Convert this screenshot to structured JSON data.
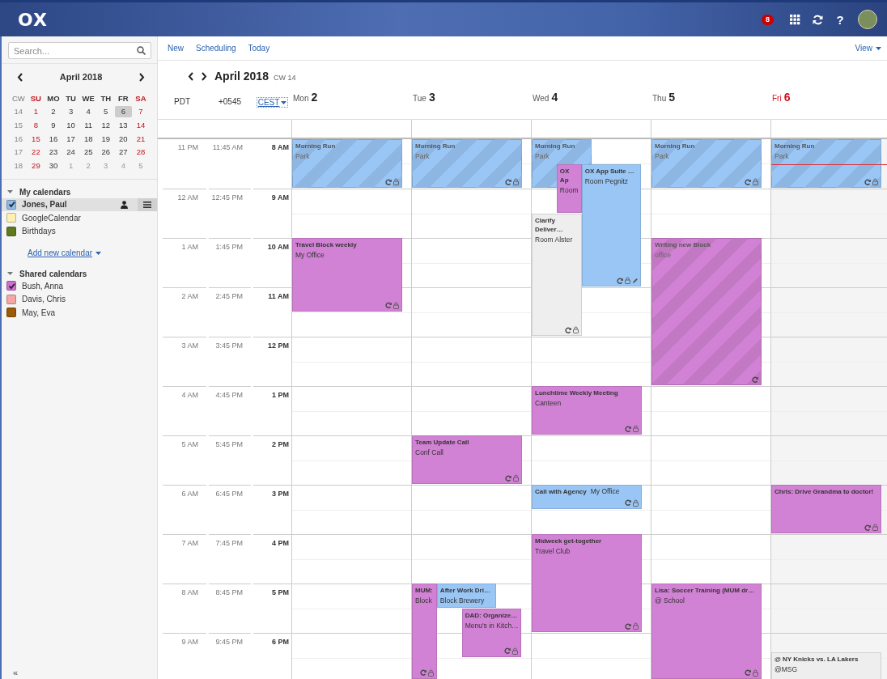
{
  "topbar": {
    "logo": "OX",
    "notification_count": "8",
    "help": "?"
  },
  "search": {
    "placeholder": "Search..."
  },
  "minical": {
    "title": "April 2018",
    "week_header": "CW",
    "headers": [
      {
        "label": "SU",
        "weekend": true
      },
      {
        "label": "MO",
        "weekend": false
      },
      {
        "label": "TU",
        "weekend": false
      },
      {
        "label": "WE",
        "weekend": false
      },
      {
        "label": "TH",
        "weekend": false
      },
      {
        "label": "FR",
        "weekend": false
      },
      {
        "label": "SA",
        "weekend": true
      }
    ],
    "weeks": [
      {
        "cw": "14",
        "days": [
          {
            "day": "1",
            "outside": false,
            "selected": false
          },
          {
            "day": "2",
            "outside": false,
            "selected": false
          },
          {
            "day": "3",
            "outside": false,
            "selected": false
          },
          {
            "day": "4",
            "outside": false,
            "selected": false
          },
          {
            "day": "5",
            "outside": false,
            "selected": false
          },
          {
            "day": "6",
            "outside": false,
            "selected": true
          },
          {
            "day": "7",
            "outside": false,
            "selected": false
          }
        ]
      },
      {
        "cw": "15",
        "days": [
          {
            "day": "8",
            "outside": false,
            "selected": false
          },
          {
            "day": "9",
            "outside": false,
            "selected": false
          },
          {
            "day": "10",
            "outside": false,
            "selected": false
          },
          {
            "day": "11",
            "outside": false,
            "selected": false
          },
          {
            "day": "12",
            "outside": false,
            "selected": false
          },
          {
            "day": "13",
            "outside": false,
            "selected": false
          },
          {
            "day": "14",
            "outside": false,
            "selected": false
          }
        ]
      },
      {
        "cw": "16",
        "days": [
          {
            "day": "15",
            "outside": false,
            "selected": false
          },
          {
            "day": "16",
            "outside": false,
            "selected": false
          },
          {
            "day": "17",
            "outside": false,
            "selected": false
          },
          {
            "day": "18",
            "outside": false,
            "selected": false
          },
          {
            "day": "19",
            "outside": false,
            "selected": false
          },
          {
            "day": "20",
            "outside": false,
            "selected": false
          },
          {
            "day": "21",
            "outside": false,
            "selected": false
          }
        ]
      },
      {
        "cw": "17",
        "days": [
          {
            "day": "22",
            "outside": false,
            "selected": false
          },
          {
            "day": "23",
            "outside": false,
            "selected": false
          },
          {
            "day": "24",
            "outside": false,
            "selected": false
          },
          {
            "day": "25",
            "outside": false,
            "selected": false
          },
          {
            "day": "26",
            "outside": false,
            "selected": false
          },
          {
            "day": "27",
            "outside": false,
            "selected": false
          },
          {
            "day": "28",
            "outside": false,
            "selected": false
          }
        ]
      },
      {
        "cw": "18",
        "days": [
          {
            "day": "29",
            "outside": false,
            "selected": false
          },
          {
            "day": "30",
            "outside": false,
            "selected": false
          },
          {
            "day": "1",
            "outside": true,
            "selected": false
          },
          {
            "day": "2",
            "outside": true,
            "selected": false
          },
          {
            "day": "3",
            "outside": true,
            "selected": false
          },
          {
            "day": "4",
            "outside": true,
            "selected": false
          },
          {
            "day": "5",
            "outside": true,
            "selected": false
          }
        ]
      }
    ]
  },
  "calendar_sections": [
    {
      "title": "My calendars",
      "expanded": true,
      "add_link": "Add new calendar",
      "items": [
        {
          "name": "Jones, Paul",
          "color": "#8dbcec",
          "checked": true,
          "selected": true
        },
        {
          "name": "GoogleCalendar",
          "color": "#fdf0b2",
          "checked": false,
          "selected": false
        },
        {
          "name": "Birthdays",
          "color": "#5f7a1e",
          "checked": false,
          "selected": false
        }
      ]
    },
    {
      "title": "Shared calendars",
      "expanded": true,
      "items": [
        {
          "name": "Bush, Anna",
          "color": "#cf6fd1",
          "checked": true,
          "selected": false
        },
        {
          "name": "Davis, Chris",
          "color": "#f3a8a6",
          "checked": false,
          "selected": false
        },
        {
          "name": "May, Eva",
          "color": "#9a5a06",
          "checked": false,
          "selected": false
        }
      ]
    }
  ],
  "collapse": "«",
  "toolbar": {
    "actions": [
      "New",
      "Scheduling",
      "Today"
    ],
    "view": "View"
  },
  "view_header": {
    "month": "April 2018",
    "week": "CW 14"
  },
  "timezones": [
    {
      "label": "PDT",
      "dropdown": false
    },
    {
      "label": "+0545",
      "dropdown": false
    },
    {
      "label": "CEST",
      "dropdown": true
    }
  ],
  "hours": [
    {
      "labels": [
        "11 PM",
        "11:45 AM",
        "8 AM"
      ]
    },
    {
      "labels": [
        "12 AM",
        "12:45 PM",
        "9 AM"
      ]
    },
    {
      "labels": [
        "1 AM",
        "1:45 PM",
        "10 AM"
      ]
    },
    {
      "labels": [
        "2 AM",
        "2:45 PM",
        "11 AM"
      ]
    },
    {
      "labels": [
        "3 AM",
        "3:45 PM",
        "12 PM"
      ]
    },
    {
      "labels": [
        "4 AM",
        "4:45 PM",
        "1 PM"
      ]
    },
    {
      "labels": [
        "5 AM",
        "5:45 PM",
        "2 PM"
      ]
    },
    {
      "labels": [
        "6 AM",
        "6:45 PM",
        "3 PM"
      ]
    },
    {
      "labels": [
        "7 AM",
        "7:45 PM",
        "4 PM"
      ]
    },
    {
      "labels": [
        "8 AM",
        "8:45 PM",
        "5 PM"
      ]
    },
    {
      "labels": [
        "9 AM",
        "9:45 PM",
        "6 PM"
      ]
    }
  ],
  "days": [
    {
      "weekday": "Mon",
      "date": "2",
      "today": false,
      "working_day": true,
      "events": [
        {
          "title": "Morning Run",
          "location": "Park",
          "color": "#9ac6f5",
          "tentative": true,
          "icons": [
            {
              "kind": "recurring"
            },
            {
              "kind": "private"
            }
          ]
        },
        {
          "title": "Travel Block weekly",
          "location": "My Office",
          "color": "#d282d4",
          "tentative": false,
          "icons": [
            {
              "kind": "recurring"
            },
            {
              "kind": "private"
            }
          ]
        }
      ]
    },
    {
      "weekday": "Tue",
      "date": "3",
      "today": false,
      "working_day": true,
      "events": [
        {
          "title": "Morning Run",
          "location": "Park",
          "color": "#9ac6f5",
          "tentative": true,
          "icons": [
            {
              "kind": "recurring"
            },
            {
              "kind": "private"
            }
          ]
        },
        {
          "title": "Team Update Call",
          "location": "Conf Call",
          "color": "#d282d4",
          "tentative": false,
          "icons": [
            {
              "kind": "recurring"
            },
            {
              "kind": "private"
            }
          ]
        },
        {
          "title": "MUM:",
          "location": "Block",
          "color": "#d282d4",
          "tentative": false,
          "icons": [
            {
              "kind": "recurring"
            },
            {
              "kind": "private"
            }
          ]
        },
        {
          "title": "After Work Dri…",
          "location": "Block Brewery",
          "color": "#9ac6f5",
          "tentative": false
        },
        {
          "title": "DAD: Organize…",
          "location": "Menu's in Kitch…",
          "color": "#d282d4",
          "tentative": false,
          "icons": [
            {
              "kind": "recurring"
            },
            {
              "kind": "private"
            }
          ]
        }
      ]
    },
    {
      "weekday": "Wed",
      "date": "4",
      "today": false,
      "working_day": true,
      "events": [
        {
          "title": "Morning Run",
          "location": "Park",
          "color": "#9ac6f5",
          "tentative": true
        },
        {
          "title": "OX Ap",
          "location": "Room",
          "color": "#d282d4",
          "tentative": false
        },
        {
          "title": "OX App Suite …",
          "location": "Room Pegnitz",
          "color": "#9ac6f5",
          "tentative": false,
          "icons": [
            {
              "kind": "recurring"
            },
            {
              "kind": "private"
            },
            {
              "kind": "note"
            }
          ]
        },
        {
          "title": "Clarify Deliver…",
          "location": "Room Alster",
          "color": "#eeeeee",
          "tentative": false,
          "icons": [
            {
              "kind": "recurring"
            },
            {
              "kind": "private"
            }
          ]
        },
        {
          "title": "Lunchtime Weekly Meeting",
          "location": "Canteen",
          "color": "#d282d4",
          "tentative": false,
          "icons": [
            {
              "kind": "recurring"
            },
            {
              "kind": "private"
            }
          ]
        },
        {
          "title": "Call with Agency",
          "location": "My Office",
          "color": "#9ac6f5",
          "tentative": false,
          "icons": [
            {
              "kind": "recurring"
            },
            {
              "kind": "private"
            }
          ]
        },
        {
          "title": "Midweek get-together",
          "location": "Travel Club",
          "color": "#d282d4",
          "tentative": false,
          "icons": [
            {
              "kind": "recurring"
            },
            {
              "kind": "private"
            }
          ]
        }
      ]
    },
    {
      "weekday": "Thu",
      "date": "5",
      "today": false,
      "working_day": true,
      "events": [
        {
          "title": "Morning Run",
          "location": "Park",
          "color": "#9ac6f5",
          "tentative": true,
          "icons": [
            {
              "kind": "recurring"
            },
            {
              "kind": "private"
            }
          ]
        },
        {
          "title": "Writing new Block",
          "location": "office",
          "color": "#d282d4",
          "tentative": true,
          "icons": [
            {
              "kind": "recurring"
            }
          ]
        },
        {
          "title": "Lisa: Soccer Training (MUM dr…",
          "location": "@ School",
          "color": "#d282d4",
          "tentative": false,
          "icons": [
            {
              "kind": "recurring"
            },
            {
              "kind": "private"
            }
          ]
        }
      ]
    },
    {
      "weekday": "Fri",
      "date": "6",
      "today": true,
      "working_day": false,
      "events": [
        {
          "title": "Morning Run",
          "location": "Park",
          "color": "#9ac6f5",
          "tentative": true,
          "icons": [
            {
              "kind": "recurring"
            },
            {
              "kind": "private"
            }
          ]
        },
        {
          "title": "Chris: Drive Grandma to doctor!",
          "color": "#d282d4",
          "tentative": false,
          "icons": [
            {
              "kind": "recurring"
            },
            {
              "kind": "private"
            }
          ]
        },
        {
          "title": "@ NY Knicks vs. LA Lakers",
          "location": "@MSG",
          "color": "#eeeeee",
          "tentative": false
        }
      ]
    }
  ]
}
